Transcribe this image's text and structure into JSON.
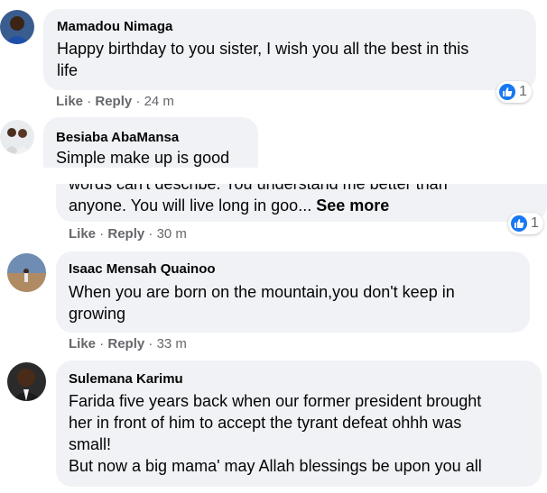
{
  "comments": [
    {
      "author": "Mamadou Nimaga",
      "lines": [
        "Happy birthday to you sister, I wish you all the best in this",
        "life"
      ],
      "like": "Like",
      "reply": "Reply",
      "time": "24 m",
      "reaction_count": "1"
    },
    {
      "author": "Besiaba AbaMansa",
      "lines": [
        "Simple make up is good"
      ]
    },
    {
      "partial_line": "words can't describe. You understand me better than",
      "lines": [
        "anyone. You will live long in goo..."
      ],
      "see_more": "See more",
      "like": "Like",
      "reply": "Reply",
      "time": "30 m",
      "reaction_count": "1"
    },
    {
      "author": "Isaac Mensah Quainoo",
      "lines": [
        "When you are born on the mountain,you don't keep in",
        "growing"
      ],
      "like": "Like",
      "reply": "Reply",
      "time": "33 m"
    },
    {
      "author": "Sulemana Karimu",
      "lines": [
        "Farida five years back when our former president brought",
        "her in front of him to accept the tyrant defeat ohhh was",
        "small!",
        "But now a big mama' may Allah blessings be upon you all"
      ]
    }
  ],
  "separator": "·",
  "icons": {
    "reaction": "thumbs-up-icon"
  },
  "colors": {
    "bubble": "#f0f2f5",
    "meta": "#65676b",
    "like_blue": "#1877f2"
  }
}
